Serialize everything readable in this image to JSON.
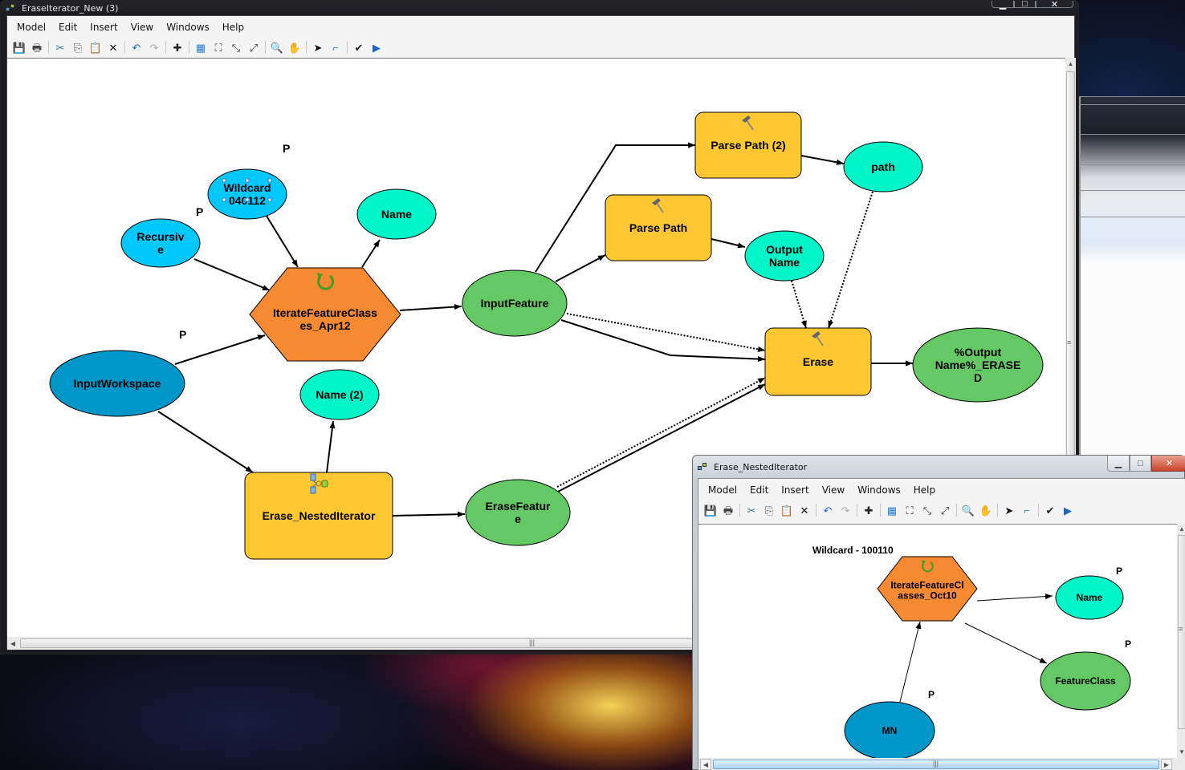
{
  "main_window": {
    "title": "EraseIterator_New (3)",
    "caption_buttons": {
      "minimize": "▁",
      "maximize": "□",
      "close": "✕"
    },
    "menu": [
      "Model",
      "Edit",
      "Insert",
      "View",
      "Windows",
      "Help"
    ],
    "toolbar": [
      {
        "name": "save-icon",
        "glyph": "💾"
      },
      {
        "name": "print-icon",
        "glyph": "🖶"
      },
      {
        "sep": true
      },
      {
        "name": "cut-icon",
        "glyph": "✂"
      },
      {
        "name": "copy-icon",
        "glyph": "⎘"
      },
      {
        "name": "paste-icon",
        "glyph": "📋"
      },
      {
        "name": "delete-icon",
        "glyph": "✕"
      },
      {
        "sep": true
      },
      {
        "name": "undo-icon",
        "glyph": "↶"
      },
      {
        "name": "redo-icon",
        "glyph": "↷"
      },
      {
        "sep": true
      },
      {
        "name": "add-data-icon",
        "glyph": "✚"
      },
      {
        "sep": true
      },
      {
        "name": "auto-layout-icon",
        "glyph": "▦"
      },
      {
        "name": "full-extent-icon",
        "glyph": "⛶"
      },
      {
        "name": "zoom-in-fixed-icon",
        "glyph": "⤡"
      },
      {
        "name": "zoom-out-fixed-icon",
        "glyph": "⤢"
      },
      {
        "sep": true
      },
      {
        "name": "zoom-icon",
        "glyph": "🔍"
      },
      {
        "name": "pan-icon",
        "glyph": "✋"
      },
      {
        "sep": true
      },
      {
        "name": "select-icon",
        "glyph": "➤"
      },
      {
        "name": "connect-icon",
        "glyph": "⌐"
      },
      {
        "sep": true
      },
      {
        "name": "validate-icon",
        "glyph": "✔"
      },
      {
        "name": "run-icon",
        "glyph": "▶"
      }
    ],
    "diagram": {
      "nodes": [
        {
          "id": "wildcard",
          "label": [
            "Wildcard",
            "040112"
          ],
          "shape": "ellipse",
          "color": "#00c8fa",
          "param": true
        },
        {
          "id": "recursive",
          "label": [
            "Recursiv",
            "e"
          ],
          "shape": "ellipse",
          "color": "#00c8fa",
          "param": true
        },
        {
          "id": "inputworkspace",
          "label": [
            "InputWorkspace"
          ],
          "shape": "ellipse",
          "color": "#0096c8",
          "param": true
        },
        {
          "id": "iterate",
          "label": [
            "IterateFeatureClass",
            "es_Apr12"
          ],
          "shape": "hexagon",
          "color": "#f58a32",
          "icon": "iterator-icon"
        },
        {
          "id": "name",
          "label": [
            "Name"
          ],
          "shape": "ellipse",
          "color": "#00f5c8"
        },
        {
          "id": "name2",
          "label": [
            "Name (2)"
          ],
          "shape": "ellipse",
          "color": "#00f5c8"
        },
        {
          "id": "nested",
          "label": [
            "Erase_NestedIterator"
          ],
          "shape": "rect",
          "color": "#ffc832",
          "icon": "model-icon"
        },
        {
          "id": "inputfeature",
          "label": [
            "InputFeature"
          ],
          "shape": "ellipse",
          "color": "#64c864"
        },
        {
          "id": "erasefeature",
          "label": [
            "EraseFeatur",
            "e"
          ],
          "shape": "ellipse",
          "color": "#64c864"
        },
        {
          "id": "parsepath2",
          "label": [
            "Parse Path (2)"
          ],
          "shape": "rect",
          "color": "#ffc832",
          "icon": "hammer-icon"
        },
        {
          "id": "parsepath",
          "label": [
            "Parse Path"
          ],
          "shape": "rect",
          "color": "#ffc832",
          "icon": "hammer-icon"
        },
        {
          "id": "path",
          "label": [
            "path"
          ],
          "shape": "ellipse",
          "color": "#00f5c8"
        },
        {
          "id": "outputname",
          "label": [
            "Output",
            "Name"
          ],
          "shape": "ellipse",
          "color": "#00f5c8"
        },
        {
          "id": "erase",
          "label": [
            "Erase"
          ],
          "shape": "rect",
          "color": "#ffc832",
          "icon": "hammer-icon"
        },
        {
          "id": "output",
          "label": [
            "%Output",
            "Name%_ERASE",
            "D"
          ],
          "shape": "ellipse",
          "color": "#64c864"
        }
      ],
      "param_marker": "P",
      "connections": [
        {
          "from": "wildcard",
          "to": "iterate",
          "style": "solid"
        },
        {
          "from": "recursive",
          "to": "iterate",
          "style": "solid"
        },
        {
          "from": "inputworkspace",
          "to": "iterate",
          "style": "solid"
        },
        {
          "from": "iterate",
          "to": "name",
          "style": "solid"
        },
        {
          "from": "iterate",
          "to": "inputfeature",
          "style": "solid"
        },
        {
          "from": "inputworkspace",
          "to": "nested",
          "style": "solid"
        },
        {
          "from": "nested",
          "to": "name2",
          "style": "solid"
        },
        {
          "from": "nested",
          "to": "erasefeature",
          "style": "solid"
        },
        {
          "from": "inputfeature",
          "to": "parsepath2",
          "style": "solid"
        },
        {
          "from": "inputfeature",
          "to": "parsepath",
          "style": "solid"
        },
        {
          "from": "parsepath2",
          "to": "path",
          "style": "solid"
        },
        {
          "from": "parsepath",
          "to": "outputname",
          "style": "solid"
        },
        {
          "from": "inputfeature",
          "to": "erase",
          "style": "solid"
        },
        {
          "from": "inputfeature",
          "to": "erase",
          "style": "dotted"
        },
        {
          "from": "erasefeature",
          "to": "erase",
          "style": "solid"
        },
        {
          "from": "erasefeature",
          "to": "erase",
          "style": "dotted"
        },
        {
          "from": "path",
          "to": "erase",
          "style": "dotted"
        },
        {
          "from": "outputname",
          "to": "erase",
          "style": "dotted"
        },
        {
          "from": "erase",
          "to": "output",
          "style": "solid"
        }
      ]
    }
  },
  "child_window": {
    "title": "Erase_NestedIterator",
    "caption_buttons": {
      "minimize": "▁",
      "maximize": "□",
      "close": "✕"
    },
    "menu": [
      "Model",
      "Edit",
      "Insert",
      "View",
      "Windows",
      "Help"
    ],
    "diagram": {
      "annotation": "Wildcard - 100110",
      "nodes": [
        {
          "id": "iterate",
          "label": [
            "IterateFeatureCl",
            "asses_Oct10"
          ],
          "shape": "hexagon",
          "color": "#f58a32",
          "icon": "iterator-icon"
        },
        {
          "id": "name",
          "label": [
            "Name"
          ],
          "shape": "ellipse",
          "color": "#00f5c8",
          "param": true
        },
        {
          "id": "featureclass",
          "label": [
            "FeatureClass"
          ],
          "shape": "ellipse",
          "color": "#64c864",
          "param": true
        },
        {
          "id": "mn",
          "label": [
            "MN"
          ],
          "shape": "ellipse",
          "color": "#0096c8",
          "param": true
        }
      ],
      "param_marker": "P",
      "connections": [
        {
          "from": "mn",
          "to": "iterate",
          "style": "solid"
        },
        {
          "from": "iterate",
          "to": "name",
          "style": "solid"
        },
        {
          "from": "iterate",
          "to": "featureclass",
          "style": "solid"
        }
      ]
    }
  }
}
